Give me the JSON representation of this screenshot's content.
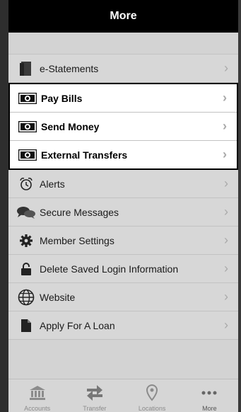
{
  "header": {
    "title": "More"
  },
  "menu": {
    "items": [
      {
        "label": "e-Statements"
      },
      {
        "label": "Pay Bills"
      },
      {
        "label": "Send Money"
      },
      {
        "label": "External Transfers"
      },
      {
        "label": "Alerts"
      },
      {
        "label": "Secure Messages"
      },
      {
        "label": "Member Settings"
      },
      {
        "label": "Delete Saved Login Information"
      },
      {
        "label": "Website"
      },
      {
        "label": "Apply For A Loan"
      }
    ],
    "chevron": "›"
  },
  "tabbar": {
    "tabs": [
      {
        "label": "Accounts",
        "icon": "bank-icon"
      },
      {
        "label": "Transfer",
        "icon": "transfer-icon"
      },
      {
        "label": "Locations",
        "icon": "location-pin-icon"
      },
      {
        "label": "More",
        "icon": "more-dots-icon",
        "active": true
      }
    ]
  }
}
